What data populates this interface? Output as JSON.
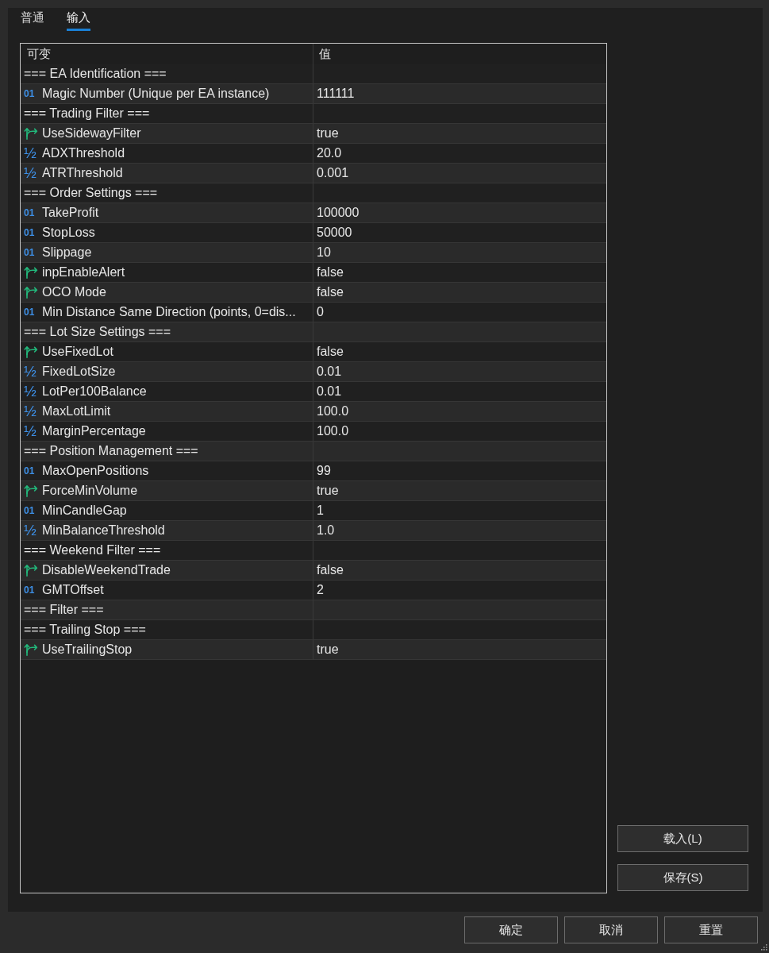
{
  "tabs": [
    {
      "label": "普通",
      "selected": false
    },
    {
      "label": "输入",
      "selected": true
    }
  ],
  "table": {
    "columns": [
      "可变",
      "值"
    ],
    "rows": [
      {
        "kind": "section",
        "name": "=== EA Identification ==="
      },
      {
        "kind": "int",
        "mark": "01",
        "name": "Magic Number (Unique per EA instance)",
        "value": "111111"
      },
      {
        "kind": "section",
        "name": "=== Trading Filter ==="
      },
      {
        "kind": "bool",
        "name": "UseSidewayFilter",
        "value": "true"
      },
      {
        "kind": "double",
        "mark": "½",
        "name": "ADXThreshold",
        "value": "20.0"
      },
      {
        "kind": "double",
        "mark": "½",
        "name": "ATRThreshold",
        "value": "0.001"
      },
      {
        "kind": "section",
        "name": "=== Order Settings ==="
      },
      {
        "kind": "int",
        "mark": "01",
        "name": "TakeProfit",
        "value": "100000"
      },
      {
        "kind": "int",
        "mark": "01",
        "name": "StopLoss",
        "value": "50000"
      },
      {
        "kind": "int",
        "mark": "01",
        "name": "Slippage",
        "value": "10"
      },
      {
        "kind": "bool",
        "name": "inpEnableAlert",
        "value": "false"
      },
      {
        "kind": "bool",
        "name": "OCO Mode",
        "value": "false"
      },
      {
        "kind": "int",
        "mark": "01",
        "name": "Min Distance Same Direction (points, 0=dis...",
        "value": "0"
      },
      {
        "kind": "section",
        "name": "=== Lot Size Settings ==="
      },
      {
        "kind": "bool",
        "name": "UseFixedLot",
        "value": "false"
      },
      {
        "kind": "double",
        "mark": "½",
        "name": "FixedLotSize",
        "value": "0.01"
      },
      {
        "kind": "double",
        "mark": "½",
        "name": "LotPer100Balance",
        "value": "0.01"
      },
      {
        "kind": "double",
        "mark": "½",
        "name": "MaxLotLimit",
        "value": "100.0"
      },
      {
        "kind": "double",
        "mark": "½",
        "name": "MarginPercentage",
        "value": "100.0"
      },
      {
        "kind": "section",
        "name": "=== Position Management ==="
      },
      {
        "kind": "int",
        "mark": "01",
        "name": "MaxOpenPositions",
        "value": "99"
      },
      {
        "kind": "bool",
        "name": "ForceMinVolume",
        "value": "true"
      },
      {
        "kind": "int",
        "mark": "01",
        "name": "MinCandleGap",
        "value": "1"
      },
      {
        "kind": "double",
        "mark": "½",
        "name": "MinBalanceThreshold",
        "value": "1.0"
      },
      {
        "kind": "section",
        "name": "=== Weekend Filter ==="
      },
      {
        "kind": "bool",
        "name": "DisableWeekendTrade",
        "value": "false"
      },
      {
        "kind": "int",
        "mark": "01",
        "name": "GMTOffset",
        "value": "2"
      },
      {
        "kind": "section",
        "name": "=== Filter ==="
      },
      {
        "kind": "section",
        "name": "=== Trailing Stop ==="
      },
      {
        "kind": "bool",
        "name": "UseTrailingStop",
        "value": "true"
      }
    ]
  },
  "side_buttons": [
    "载入(L)",
    "保存(S)"
  ],
  "dialog_buttons": [
    "确定",
    "取消",
    "重置"
  ]
}
